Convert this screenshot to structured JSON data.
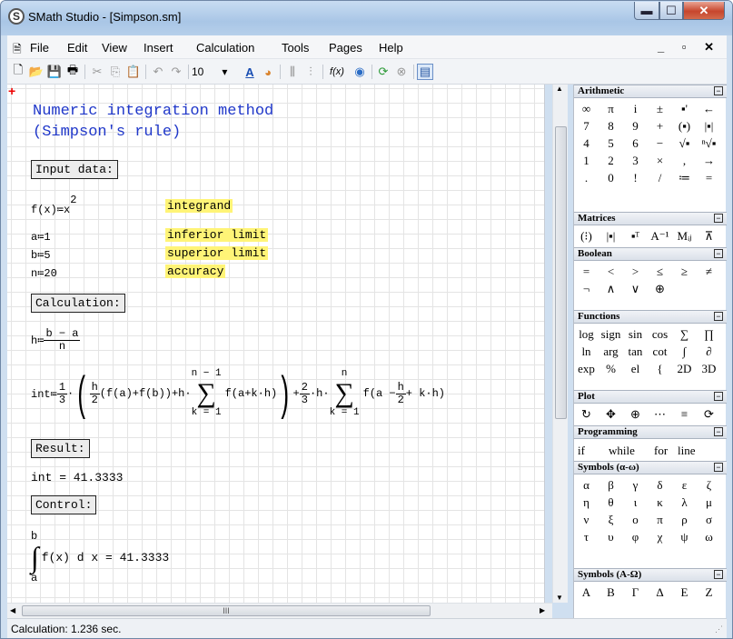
{
  "window": {
    "title": "SMath Studio - [Simpson.sm]",
    "app_icon": "S",
    "minimize": "▬",
    "maximize": "☐",
    "close": "✕"
  },
  "menu": {
    "items": [
      "File",
      "Edit",
      "View",
      "Insert",
      "Calculation",
      "Tools",
      "Pages",
      "Help"
    ],
    "mdi_controls": "_ ▫ ✕"
  },
  "toolbar": {
    "font_size": "10",
    "fx_label": "f(x)"
  },
  "document": {
    "heading_line1": "Numeric integration method",
    "heading_line2": "(Simpson's rule)",
    "input_data_label": "Input data:",
    "f_def_lhs": "f(x)≔x",
    "f_def_exp": "2",
    "integrand_label": "integrand",
    "a_def": "a≔1",
    "a_label": "inferior limit",
    "b_def": "b≔5",
    "b_label": "superior limit",
    "n_def": "n≔20",
    "n_label": "accuracy",
    "calculation_label": "Calculation:",
    "h_lhs": "h≔",
    "h_num": "b − a",
    "h_den": "n",
    "int_lhs": "int≔",
    "result_label": "Result:",
    "result_value": "int = 41.3333",
    "control_label": "Control:",
    "control_upper": "b",
    "control_lower": "a",
    "control_expr": "f(x) d x = 41.3333"
  },
  "formula": {
    "one": "1",
    "three": "3",
    "h": "h",
    "two": "2",
    "part1": "(f(a)+f(b))+h·",
    "sum1_top": "n − 1",
    "sum1_bot": "k = 1",
    "sum1_body": "f(a+k·h)",
    "plus": "+",
    "two_b": "2",
    "three_b": "3",
    "mid": "·h·",
    "sum2_top": "n",
    "sum2_bot": "k = 1",
    "sum2_body_a": "f(a −",
    "sum2_h": "h",
    "sum2_2": "2",
    "sum2_body_b": "+ k·h)"
  },
  "panel": {
    "arithmetic": {
      "title": "Arithmetic",
      "cells": [
        "∞",
        "π",
        "i",
        "±",
        "▪'",
        "←",
        "7",
        "8",
        "9",
        "+",
        "(▪)",
        "|▪|",
        "4",
        "5",
        "6",
        "−",
        "√▪",
        "ⁿ√▪",
        "1",
        "2",
        "3",
        "×",
        ",",
        "→",
        ".",
        "0",
        "!",
        "/",
        "≔",
        "="
      ]
    },
    "matrices": {
      "title": "Matrices",
      "cells": [
        "(⁝)",
        "|▪|",
        "▪ᵀ",
        "A⁻¹",
        "Mᵢⱼ",
        "⊼"
      ]
    },
    "boolean": {
      "title": "Boolean",
      "cells": [
        "=",
        "<",
        ">",
        "≤",
        "≥",
        "≠",
        "¬",
        "∧",
        "∨",
        "⊕"
      ]
    },
    "functions": {
      "title": "Functions",
      "rows": [
        [
          "log",
          "sign",
          "sin",
          "cos",
          "∑",
          "∏"
        ],
        [
          "ln",
          "arg",
          "tan",
          "cot",
          "∫",
          "∂"
        ],
        [
          "exp",
          "%",
          "el",
          "{",
          "2D",
          "3D"
        ]
      ]
    },
    "plot": {
      "title": "Plot",
      "cells": [
        "↻",
        "✥",
        "⊕",
        "⋯",
        "≡",
        "⟳"
      ]
    },
    "programming": {
      "title": "Programming",
      "items": [
        "if",
        "while",
        "for",
        "line"
      ]
    },
    "greek_lower": {
      "title": "Symbols (α-ω)",
      "cells": [
        "α",
        "β",
        "γ",
        "δ",
        "ε",
        "ζ",
        "η",
        "θ",
        "ι",
        "κ",
        "λ",
        "μ",
        "ν",
        "ξ",
        "ο",
        "π",
        "ρ",
        "σ",
        "τ",
        "υ",
        "φ",
        "χ",
        "ψ",
        "ω"
      ]
    },
    "greek_upper": {
      "title": "Symbols (A-Ω)",
      "cells": [
        "Α",
        "Β",
        "Γ",
        "Δ",
        "Ε",
        "Ζ"
      ]
    }
  },
  "hscroll_grip": "III",
  "status": {
    "text": "Calculation: 1.236 sec."
  }
}
